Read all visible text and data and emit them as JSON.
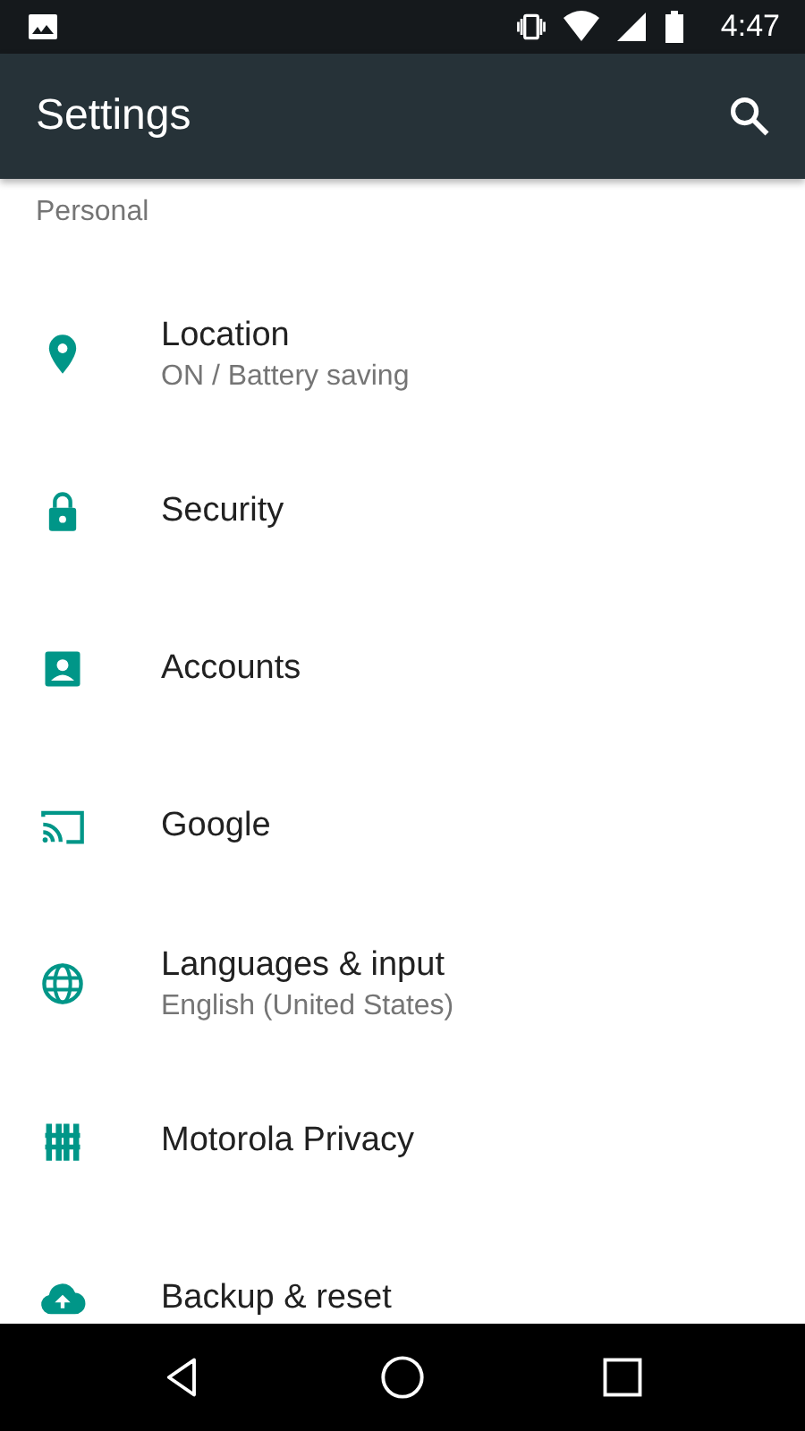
{
  "status_bar": {
    "time": "4:47"
  },
  "toolbar": {
    "title": "Settings"
  },
  "section": {
    "title": "Personal"
  },
  "items": [
    {
      "kind": "location",
      "label": "Location",
      "summary": "ON / Battery saving"
    },
    {
      "kind": "security",
      "label": "Security"
    },
    {
      "kind": "accounts",
      "label": "Accounts"
    },
    {
      "kind": "google",
      "label": "Google"
    },
    {
      "kind": "language",
      "label": "Languages & input",
      "summary": "English (United States)"
    },
    {
      "kind": "privacy",
      "label": "Motorola Privacy"
    },
    {
      "kind": "backup",
      "label": "Backup & reset"
    }
  ]
}
